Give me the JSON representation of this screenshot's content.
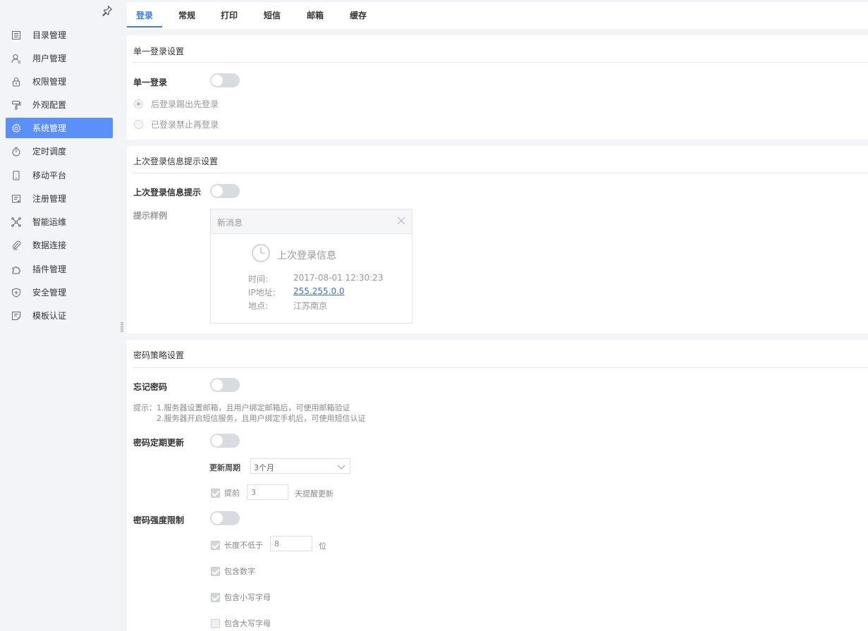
{
  "sidebar": {
    "items": [
      {
        "label": "目录管理",
        "icon": "list-icon"
      },
      {
        "label": "用户管理",
        "icon": "user-icon"
      },
      {
        "label": "权限管理",
        "icon": "lock-icon"
      },
      {
        "label": "外观配置",
        "icon": "paint-roller-icon"
      },
      {
        "label": "系统管理",
        "icon": "gear-icon",
        "active": true
      },
      {
        "label": "定时调度",
        "icon": "stopwatch-icon"
      },
      {
        "label": "移动平台",
        "icon": "mobile-icon"
      },
      {
        "label": "注册管理",
        "icon": "register-icon"
      },
      {
        "label": "智能运维",
        "icon": "network-icon"
      },
      {
        "label": "数据连接",
        "icon": "paperclip-icon"
      },
      {
        "label": "插件管理",
        "icon": "puzzle-icon"
      },
      {
        "label": "安全管理",
        "icon": "shield-icon"
      },
      {
        "label": "模板认证",
        "icon": "template-icon"
      }
    ]
  },
  "tabs": [
    {
      "label": "登录",
      "active": true
    },
    {
      "label": "常规"
    },
    {
      "label": "打印"
    },
    {
      "label": "短信"
    },
    {
      "label": "邮箱"
    },
    {
      "label": "缓存"
    }
  ],
  "sso": {
    "title": "单一登录设置",
    "label": "单一登录",
    "options": [
      "后登录踢出先登录",
      "已登录禁止再登录"
    ],
    "selected": 0
  },
  "last_login": {
    "title": "上次登录信息提示设置",
    "label": "上次登录信息提示",
    "example_label": "提示样例",
    "card": {
      "header": "新消息",
      "title": "上次登录信息",
      "rows": [
        {
          "key": "时间:",
          "value": "2017-08-01 12:30:23"
        },
        {
          "key": "IP地址:",
          "value": "255.255.0.0"
        },
        {
          "key": "地点:",
          "value": "江苏南京"
        }
      ]
    }
  },
  "password": {
    "title": "密码策略设置",
    "forget_label": "忘记密码",
    "tip_line1": "提示：1.服务器设置邮箱，且用户绑定邮箱后，可使用邮箱验证",
    "tip_line2": "2.服务器开启短信服务，且用户绑定手机后，可使用短信认证",
    "update_label": "密码定期更新",
    "period_label": "更新周期",
    "period_value": "3个月",
    "advance_label": "提前",
    "advance_value": "3",
    "advance_suffix": "天提醒更新",
    "strength_label": "密码强度限制",
    "min_length_label": "长度不低于",
    "min_length_value": "8",
    "min_length_suffix": "位",
    "include_digits": "包含数字",
    "include_lower": "包含小写字母",
    "include_upper": "包含大写字母"
  },
  "colors": {
    "accent": "#3a7ee6",
    "active_nav": "#5b8ff9"
  }
}
